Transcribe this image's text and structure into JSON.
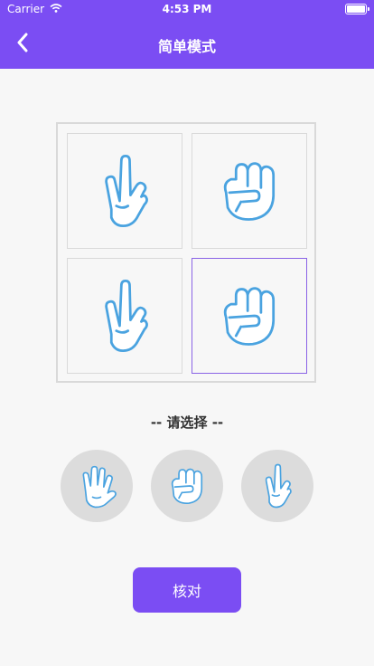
{
  "status_bar": {
    "carrier": "Carrier",
    "time": "4:53 PM"
  },
  "nav": {
    "title": "简单模式",
    "back_icon": "chevron-left-icon"
  },
  "grid": {
    "cells": [
      {
        "gesture": "scissors",
        "selected": false
      },
      {
        "gesture": "rock",
        "selected": false
      },
      {
        "gesture": "scissors",
        "selected": false
      },
      {
        "gesture": "rock",
        "selected": true
      }
    ]
  },
  "prompt": "-- 请选择 --",
  "choices": [
    {
      "gesture": "paper"
    },
    {
      "gesture": "rock"
    },
    {
      "gesture": "scissors"
    }
  ],
  "confirm_label": "核对",
  "colors": {
    "accent": "#7b4df3",
    "hand_stroke": "#4aa3e0",
    "selected_border": "#8a63e6"
  }
}
